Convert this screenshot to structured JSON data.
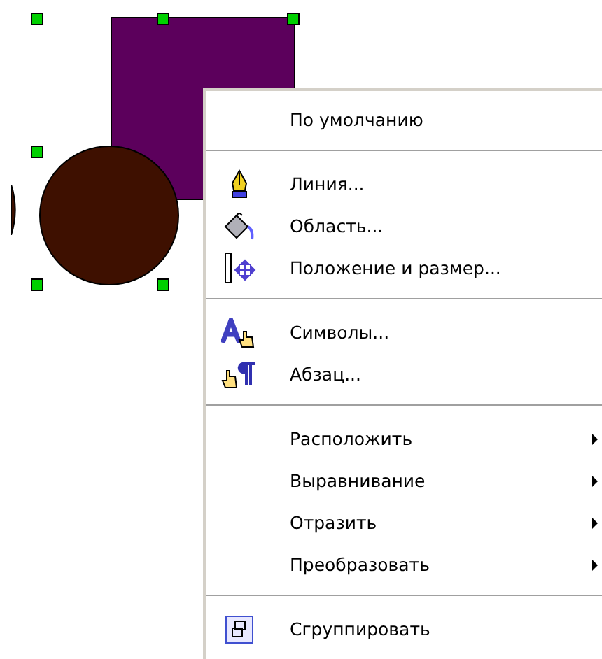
{
  "menu": {
    "items": [
      {
        "kind": "plain",
        "label": "По умолчанию"
      },
      {
        "kind": "separator"
      },
      {
        "kind": "icon",
        "label": "Линия..."
      },
      {
        "kind": "icon",
        "label": "Область..."
      },
      {
        "kind": "icon",
        "label": "Положение и размер..."
      },
      {
        "kind": "separator"
      },
      {
        "kind": "icon",
        "label": "Символы..."
      },
      {
        "kind": "icon",
        "label": "Абзац..."
      },
      {
        "kind": "separator"
      },
      {
        "kind": "submenu",
        "label": "Расположить"
      },
      {
        "kind": "submenu",
        "label": "Выравнивание"
      },
      {
        "kind": "submenu",
        "label": "Отразить"
      },
      {
        "kind": "submenu",
        "label": "Преобразовать"
      },
      {
        "kind": "separator"
      },
      {
        "kind": "icon",
        "label": "Сгруппировать"
      }
    ]
  }
}
